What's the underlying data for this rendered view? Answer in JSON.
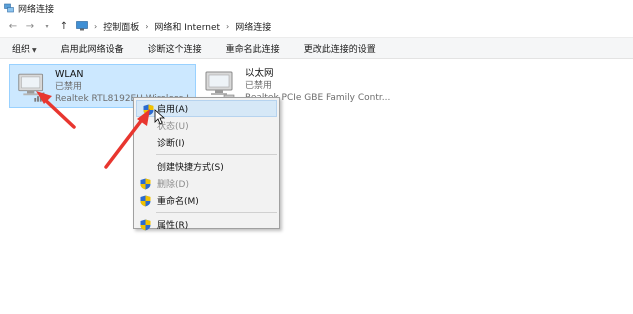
{
  "window": {
    "title": "网络连接"
  },
  "address": {
    "breadcrumbs": [
      "控制面板",
      "网络和 Internet",
      "网络连接"
    ]
  },
  "toolbar": {
    "organize": "组织",
    "enable_device": "启用此网络设备",
    "diagnose": "诊断这个连接",
    "rename": "重命名此连接",
    "change_settings": "更改此连接的设置"
  },
  "connections": [
    {
      "name": "WLAN",
      "status": "已禁用",
      "device": "Realtek RTL8192EU Wireless L..."
    },
    {
      "name": "以太网",
      "status": "已禁用",
      "device": "Realtek PCIe GBE Family Contr..."
    }
  ],
  "context_menu": {
    "items": [
      {
        "label": "启用(A)",
        "disabled": false,
        "shield": true
      },
      {
        "label": "状态(U)",
        "disabled": true,
        "shield": false
      },
      {
        "label": "诊断(I)",
        "disabled": false,
        "shield": false
      },
      {
        "label": "创建快捷方式(S)",
        "disabled": false,
        "shield": false
      },
      {
        "label": "删除(D)",
        "disabled": true,
        "shield": true
      },
      {
        "label": "重命名(M)",
        "disabled": false,
        "shield": true
      },
      {
        "label": "属性(R)",
        "disabled": false,
        "shield": true
      }
    ]
  },
  "colors": {
    "selection": "#cce8ff",
    "annotation_arrow": "#e8362f"
  }
}
